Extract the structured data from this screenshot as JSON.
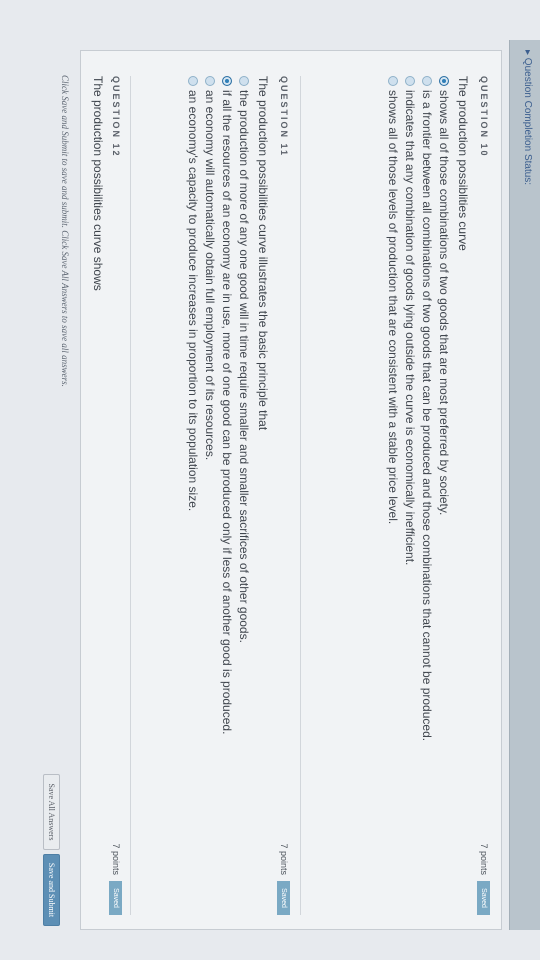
{
  "status": {
    "link_label": "▸ Question Completion Status:"
  },
  "questions": [
    {
      "heading": "QUESTION 10",
      "points": "7 points",
      "saved_label": "Saved",
      "prompt": "The production possiblities curve",
      "options": [
        {
          "text": "shows all of those combinations of two goods that are most preferred by society.",
          "selected": true
        },
        {
          "text": "is a frontier between all combinations of two goods that can be produced and those combinations that cannot be produced.",
          "selected": false
        },
        {
          "text": "indicates that any combination of goods lying outside the curve is economically inefficient.",
          "selected": false
        },
        {
          "text": "shows all of those levels of production that are consistent with a stable price level.",
          "selected": false
        }
      ]
    },
    {
      "heading": "QUESTION 11",
      "points": "7 points",
      "saved_label": "Saved",
      "prompt": "The production possibilities curve illustrates the basic principle that",
      "options": [
        {
          "text": "the production of more of any one good will in time require smaller and smaller sacrifices of other goods.",
          "selected": false
        },
        {
          "text": "if all the resources of an economy are in use, more of one good can be produced only if less of another good is produced.",
          "selected": true
        },
        {
          "text": "an economy will automatically obtain full employment of its resources.",
          "selected": false
        },
        {
          "text": "an economy's capacity to produce increases in proportion to its population size.",
          "selected": false
        }
      ]
    },
    {
      "heading": "QUESTION 12",
      "points": "7 points",
      "saved_label": "Saved",
      "prompt": "The production possibilities curve shows"
    }
  ],
  "footer": {
    "note": "Click Save and Submit to save and submit. Click Save All Answers to save all answers.",
    "save_all_label": "Save All Answers",
    "submit_label": "Save and Submit"
  }
}
